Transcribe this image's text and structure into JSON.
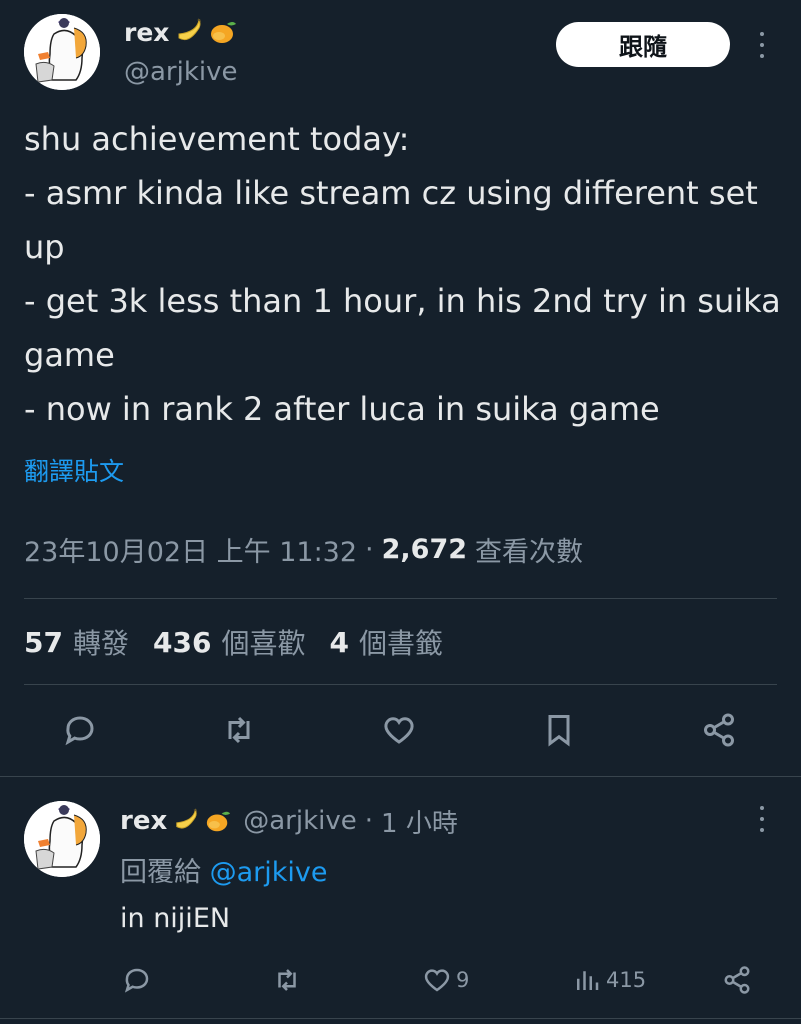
{
  "tweet": {
    "author_name": "rex",
    "name_emojis": [
      "banana-emoji",
      "mango-emoji"
    ],
    "handle": "@arjkive",
    "follow_label": "跟隨",
    "text": "shu achievement today:\n- asmr kinda like stream cz using different set up\n- get 3k less than 1 hour, in his 2nd try in suika game\n- now in rank 2 after luca in suika game",
    "translate_label": "翻譯貼文",
    "timestamp": "23年10月02日 上午 11:32",
    "separator": "·",
    "views_count": "2,672",
    "views_label": "查看次數",
    "stats": {
      "retweets_count": "57",
      "retweets_label": "轉發",
      "likes_count": "436",
      "likes_label": "個喜歡",
      "bookmarks_count": "4",
      "bookmarks_label": "個書籤"
    },
    "actions": [
      "reply-icon",
      "retweet-icon",
      "like-icon",
      "bookmark-icon",
      "share-icon"
    ]
  },
  "reply": {
    "author_name": "rex",
    "handle": "@arjkive",
    "time_separator": "·",
    "time": "1 小時",
    "reply_to_label": "回覆給",
    "reply_to_handle": "@arjkive",
    "text": "in nijiEN",
    "likes_count": "9",
    "views_count": "415",
    "actions": [
      "reply-icon",
      "retweet-icon",
      "like-icon",
      "views-icon",
      "share-icon"
    ]
  },
  "colors": {
    "background": "#15202b",
    "text": "#e7e9ea",
    "secondary": "#8b98a5",
    "accent": "#1d9bf0",
    "divider": "#38444d"
  }
}
